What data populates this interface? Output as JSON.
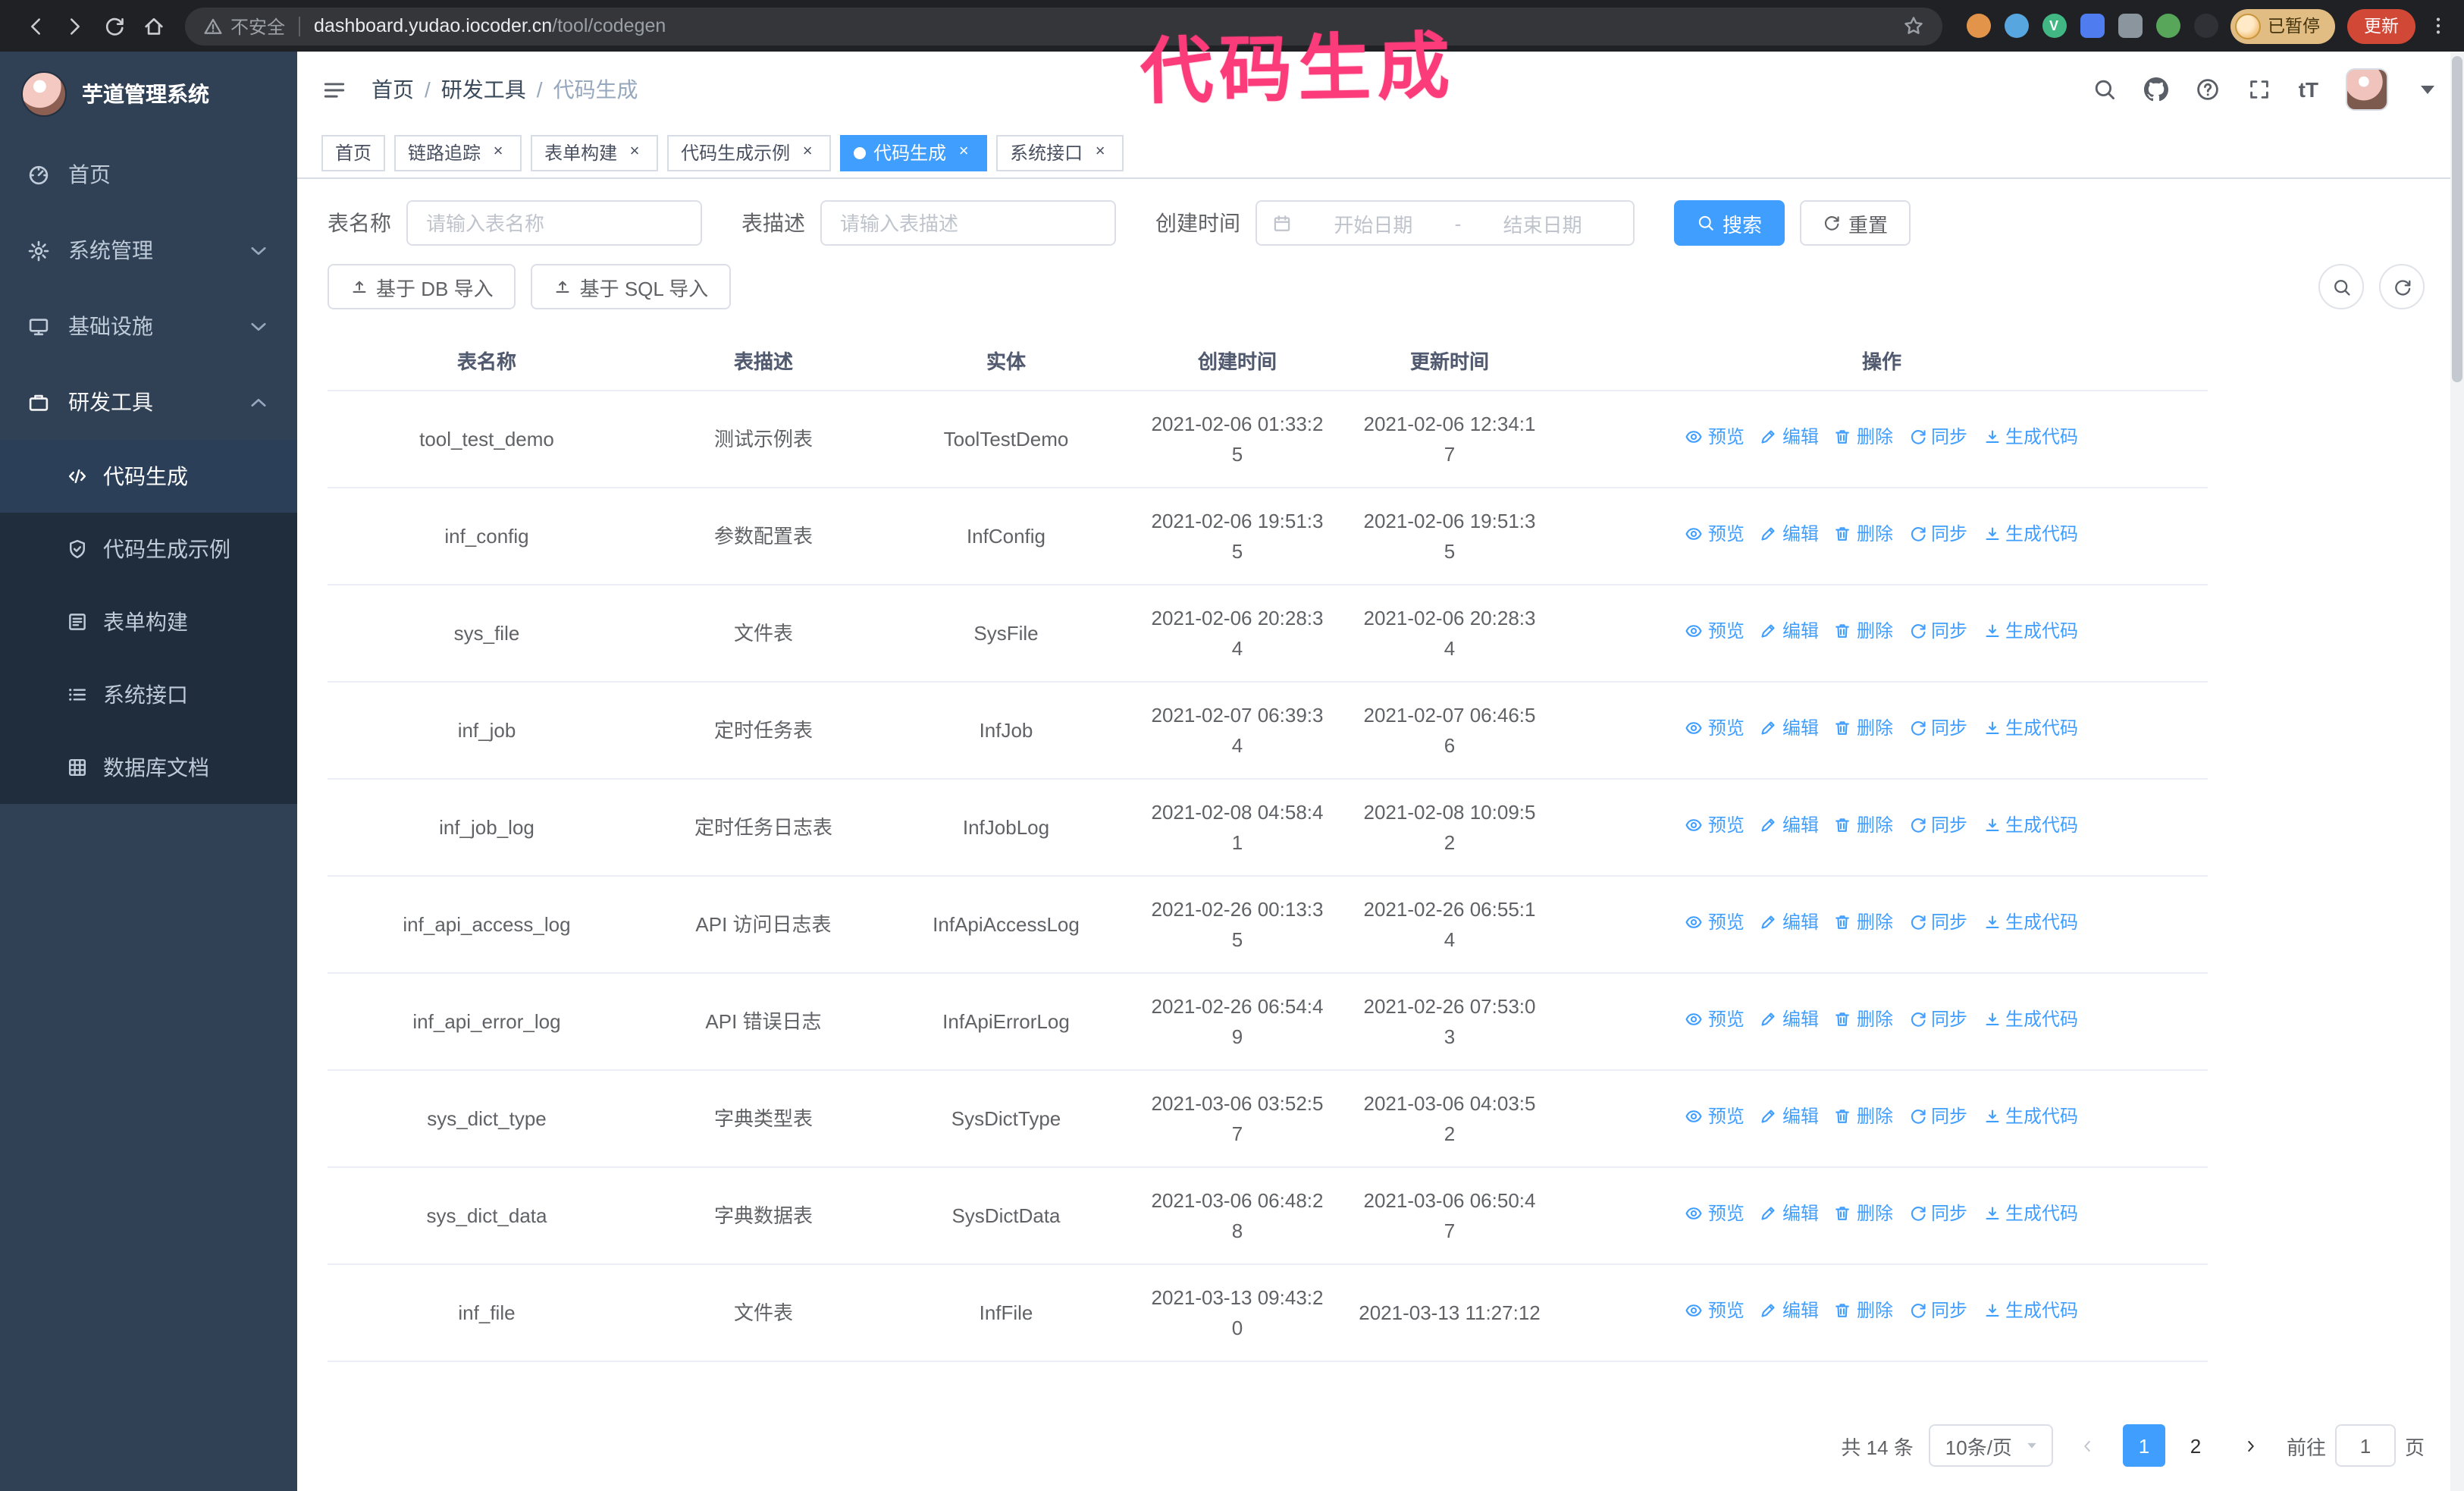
{
  "colors": {
    "accent": "#409eff",
    "sidebar_bg": "#304156",
    "submenu_bg": "#1f2d3d",
    "chrome_bg": "#202124",
    "annotation_pink": "#fb3b7a",
    "update_red": "#d14836",
    "paused_tan": "#e2bd83"
  },
  "annotation": {
    "text": "代码生成"
  },
  "browser": {
    "security_label": "不安全",
    "url_host": "dashboard.yudao.iocoder.cn",
    "url_path": "/tool/codegen",
    "paused_badge": "已暂停",
    "update_button": "更新",
    "extensions": [
      {
        "color": "#e2944a",
        "shape": "circle"
      },
      {
        "color": "#58a6e0",
        "shape": "circle"
      },
      {
        "color": "#41b883",
        "shape": "circle",
        "glyph": "V"
      },
      {
        "color": "#4f7df0",
        "shape": "square"
      },
      {
        "color": "#8a959e",
        "shape": "square"
      },
      {
        "color": "#57a65a",
        "shape": "circle"
      },
      {
        "color": "#2f3137",
        "shape": "circle"
      }
    ]
  },
  "sidebar": {
    "logo_title": "芋道管理系统",
    "items": [
      {
        "id": "home",
        "label": "首页",
        "icon": "dashboard"
      },
      {
        "id": "system",
        "label": "系统管理",
        "icon": "gear",
        "chevron": "down"
      },
      {
        "id": "infra",
        "label": "基础设施",
        "icon": "monitor",
        "chevron": "down"
      },
      {
        "id": "devtools",
        "label": "研发工具",
        "icon": "tools",
        "chevron": "up",
        "open": true,
        "children": [
          {
            "id": "codegen",
            "label": "代码生成",
            "icon": "code",
            "active": true
          },
          {
            "id": "codegen-example",
            "label": "代码生成示例",
            "icon": "shield"
          },
          {
            "id": "form-builder",
            "label": "表单构建",
            "icon": "form"
          },
          {
            "id": "system-api",
            "label": "系统接口",
            "icon": "api"
          },
          {
            "id": "db-doc",
            "label": "数据库文档",
            "icon": "grid"
          }
        ]
      }
    ]
  },
  "header": {
    "breadcrumb": [
      "首页",
      "研发工具",
      "代码生成"
    ],
    "separator": "/"
  },
  "tabs": [
    {
      "label": "首页"
    },
    {
      "label": "链路追踪",
      "closable": true
    },
    {
      "label": "表单构建",
      "closable": true
    },
    {
      "label": "代码生成示例",
      "closable": true
    },
    {
      "label": "代码生成",
      "closable": true,
      "active": true
    },
    {
      "label": "系统接口",
      "closable": true
    }
  ],
  "filters": {
    "table_name_label": "表名称",
    "table_name_placeholder": "请输入表名称",
    "table_desc_label": "表描述",
    "table_desc_placeholder": "请输入表描述",
    "create_time_label": "创建时间",
    "date_start_placeholder": "开始日期",
    "date_range_separator": "-",
    "date_end_placeholder": "结束日期",
    "search_button": "搜索",
    "reset_button": "重置"
  },
  "toolbar": {
    "import_db": "基于 DB 导入",
    "import_sql": "基于 SQL 导入"
  },
  "table": {
    "columns": [
      "表名称",
      "表描述",
      "实体",
      "创建时间",
      "更新时间",
      "操作"
    ],
    "actions": [
      {
        "label": "预览",
        "icon": "eye"
      },
      {
        "label": "编辑",
        "icon": "edit"
      },
      {
        "label": "删除",
        "icon": "del"
      },
      {
        "label": "同步",
        "icon": "sync"
      },
      {
        "label": "生成代码",
        "icon": "download"
      }
    ],
    "rows": [
      {
        "name": "tool_test_demo",
        "desc": "测试示例表",
        "entity": "ToolTestDemo",
        "created": "2021-02-06 01:33:25",
        "updated": "2021-02-06 12:34:17"
      },
      {
        "name": "inf_config",
        "desc": "参数配置表",
        "entity": "InfConfig",
        "created": "2021-02-06 19:51:35",
        "updated": "2021-02-06 19:51:35"
      },
      {
        "name": "sys_file",
        "desc": "文件表",
        "entity": "SysFile",
        "created": "2021-02-06 20:28:34",
        "updated": "2021-02-06 20:28:34"
      },
      {
        "name": "inf_job",
        "desc": "定时任务表",
        "entity": "InfJob",
        "created": "2021-02-07 06:39:34",
        "updated": "2021-02-07 06:46:56"
      },
      {
        "name": "inf_job_log",
        "desc": "定时任务日志表",
        "entity": "InfJobLog",
        "created": "2021-02-08 04:58:41",
        "updated": "2021-02-08 10:09:52"
      },
      {
        "name": "inf_api_access_log",
        "desc": "API 访问日志表",
        "entity": "InfApiAccessLog",
        "created": "2021-02-26 00:13:35",
        "updated": "2021-02-26 06:55:14"
      },
      {
        "name": "inf_api_error_log",
        "desc": "API 错误日志",
        "entity": "InfApiErrorLog",
        "created": "2021-02-26 06:54:49",
        "updated": "2021-02-26 07:53:03"
      },
      {
        "name": "sys_dict_type",
        "desc": "字典类型表",
        "entity": "SysDictType",
        "created": "2021-03-06 03:52:57",
        "updated": "2021-03-06 04:03:52"
      },
      {
        "name": "sys_dict_data",
        "desc": "字典数据表",
        "entity": "SysDictData",
        "created": "2021-03-06 06:48:28",
        "updated": "2021-03-06 06:50:47"
      },
      {
        "name": "inf_file",
        "desc": "文件表",
        "entity": "InfFile",
        "created": "2021-03-13 09:43:20",
        "updated": "2021-03-13 11:27:12"
      }
    ]
  },
  "pagination": {
    "total": "共 14 条",
    "page_size": "10条/页",
    "pages": [
      {
        "label": "1",
        "active": true
      },
      {
        "label": "2"
      }
    ],
    "goto_label": "前往",
    "goto_value": "1",
    "goto_suffix": "页"
  }
}
